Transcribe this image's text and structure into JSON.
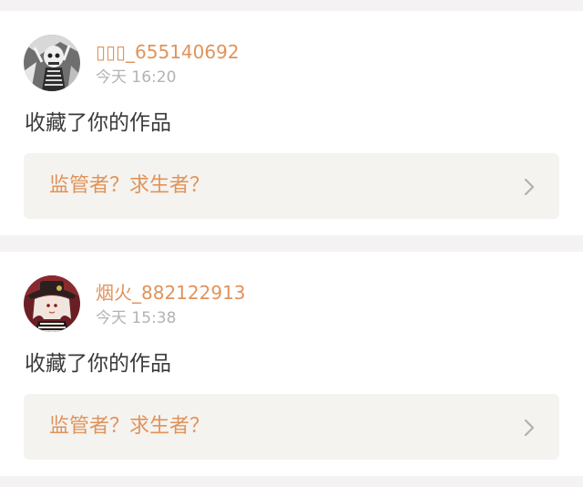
{
  "notifications": [
    {
      "username": "▯▯▯_655140692",
      "time": "今天 16:20",
      "action": "收藏了你的作品",
      "work_title": "监管者？求生者？",
      "avatar_icon": "skeleton-avatar-icon"
    },
    {
      "username": "烟火_882122913",
      "time": "今天 15:38",
      "action": "收藏了你的作品",
      "work_title": "监管者？求生者？",
      "avatar_icon": "anime-girl-avatar-icon"
    }
  ],
  "colors": {
    "accent": "#e0935c",
    "timestamp": "#b3b3b3",
    "text": "#3a3a3a",
    "link_bg": "#f4f3ef",
    "page_bg": "#f4f2f2",
    "card_bg": "#ffffff"
  }
}
